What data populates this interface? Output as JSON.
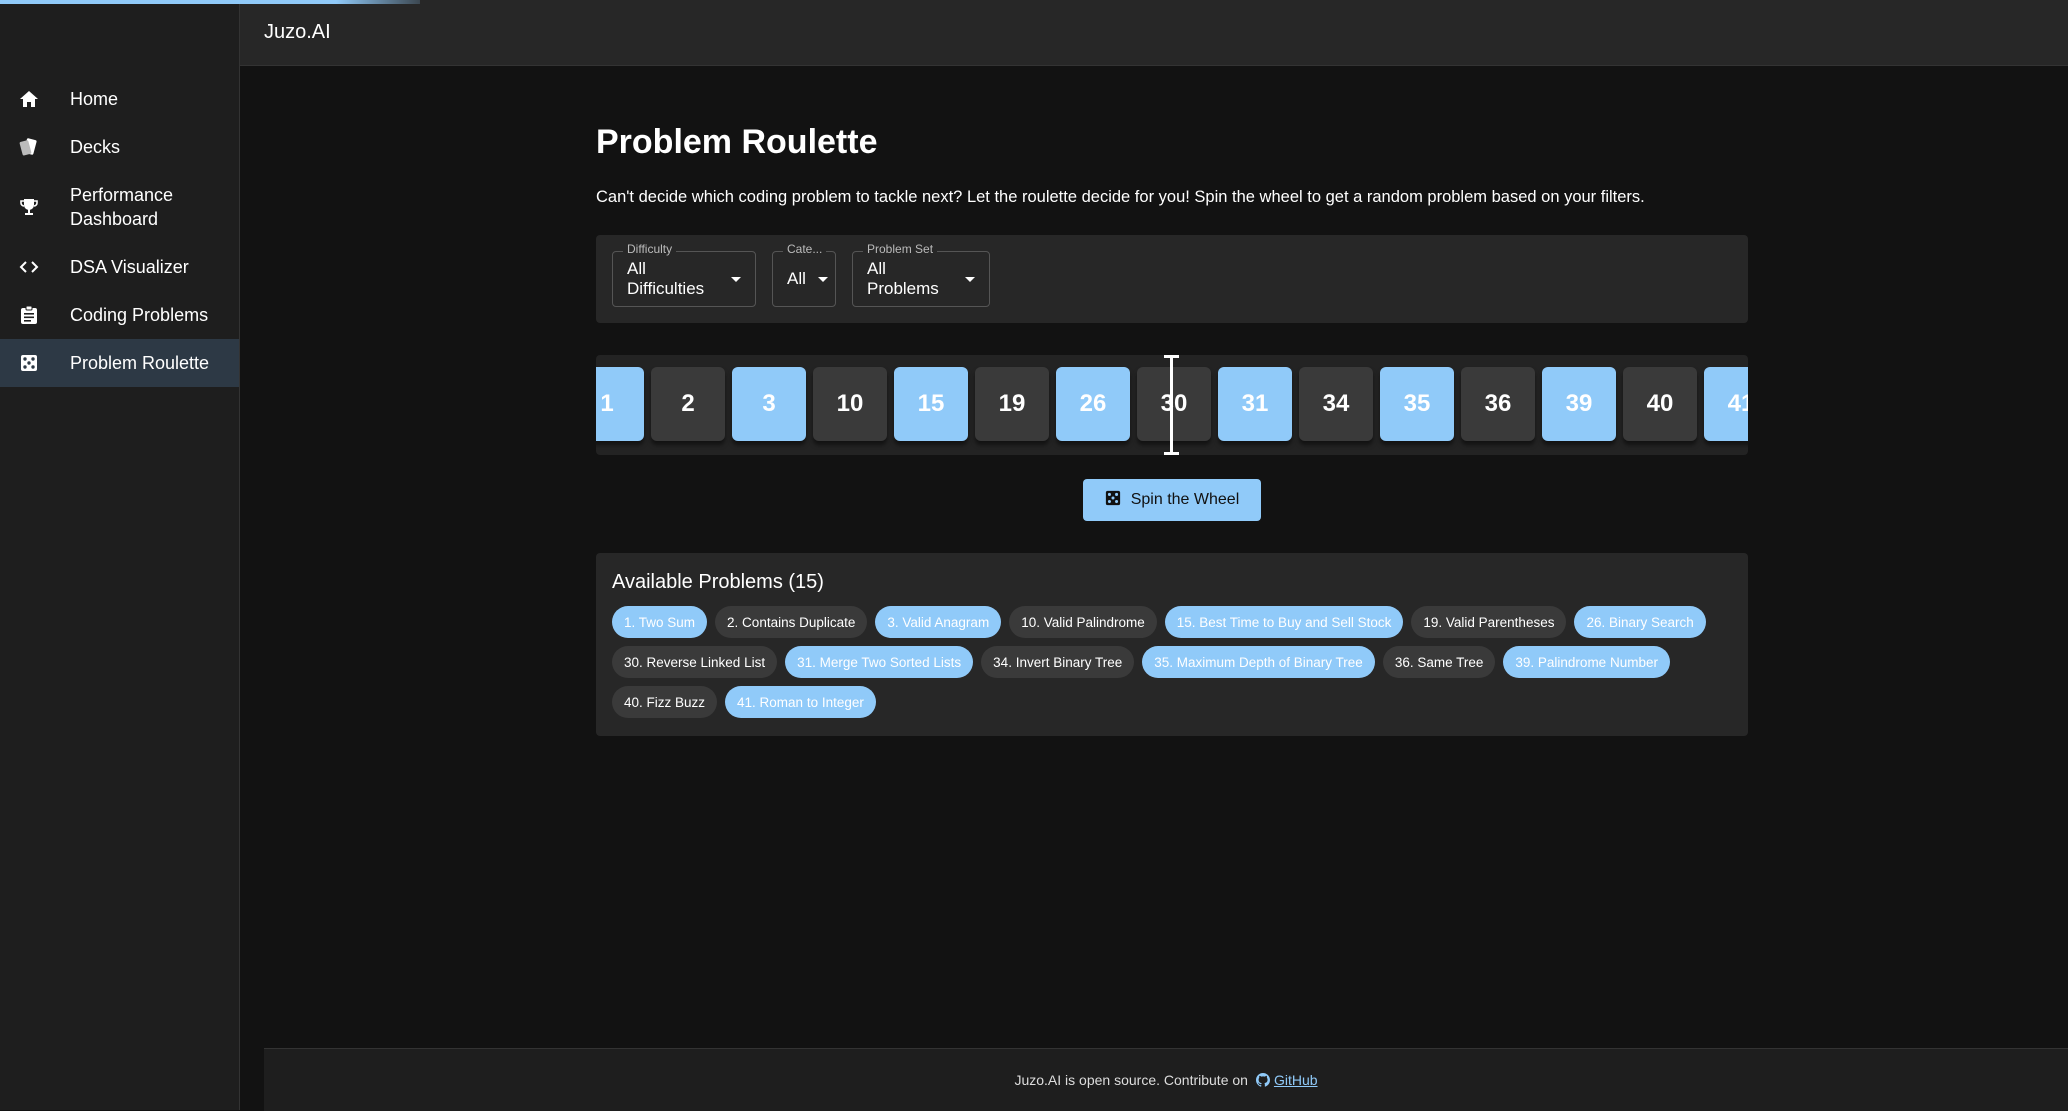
{
  "app": {
    "brand": "Juzo.AI"
  },
  "sidebar": {
    "items": [
      {
        "label": "Home",
        "icon": "home-icon"
      },
      {
        "label": "Decks",
        "icon": "cards-icon"
      },
      {
        "label": "Performance Dashboard",
        "icon": "trophy-icon"
      },
      {
        "label": "DSA Visualizer",
        "icon": "code-icon"
      },
      {
        "label": "Coding Problems",
        "icon": "clipboard-icon"
      },
      {
        "label": "Problem Roulette",
        "icon": "dice-icon",
        "active": true
      }
    ]
  },
  "main": {
    "title": "Problem Roulette",
    "description": "Can't decide which coding problem to tackle next? Let the roulette decide for you! Spin the wheel to get a random problem based on your filters.",
    "filters": {
      "difficulty": {
        "label": "Difficulty",
        "value": "All Difficulties"
      },
      "category": {
        "label": "Cate...",
        "value": "All"
      },
      "problem_set": {
        "label": "Problem Set",
        "value": "All Problems"
      }
    },
    "wheel": {
      "tiles": [
        "1",
        "2",
        "3",
        "10",
        "15",
        "19",
        "26",
        "30",
        "31",
        "34",
        "35",
        "36",
        "39",
        "40",
        "41"
      ],
      "highlighted": [
        "1",
        "3",
        "15",
        "26",
        "31",
        "35",
        "39",
        "41"
      ]
    },
    "spin_button": "Spin the Wheel",
    "available": {
      "title": "Available Problems (15)",
      "problems": [
        {
          "label": "1. Two Sum",
          "hl": true
        },
        {
          "label": "2. Contains Duplicate",
          "hl": false
        },
        {
          "label": "3. Valid Anagram",
          "hl": true
        },
        {
          "label": "10. Valid Palindrome",
          "hl": false
        },
        {
          "label": "15. Best Time to Buy and Sell Stock",
          "hl": true
        },
        {
          "label": "19. Valid Parentheses",
          "hl": false
        },
        {
          "label": "26. Binary Search",
          "hl": true
        },
        {
          "label": "30. Reverse Linked List",
          "hl": false
        },
        {
          "label": "31. Merge Two Sorted Lists",
          "hl": true
        },
        {
          "label": "34. Invert Binary Tree",
          "hl": false
        },
        {
          "label": "35. Maximum Depth of Binary Tree",
          "hl": true
        },
        {
          "label": "36. Same Tree",
          "hl": false
        },
        {
          "label": "39. Palindrome Number",
          "hl": true
        },
        {
          "label": "40. Fizz Buzz",
          "hl": false
        },
        {
          "label": "41. Roman to Integer",
          "hl": true
        }
      ]
    }
  },
  "footer": {
    "text": "Juzo.AI is open source. Contribute on",
    "link": "GitHub"
  },
  "colors": {
    "accent": "#90caf9",
    "bg": "#121212",
    "panel": "#272727"
  }
}
